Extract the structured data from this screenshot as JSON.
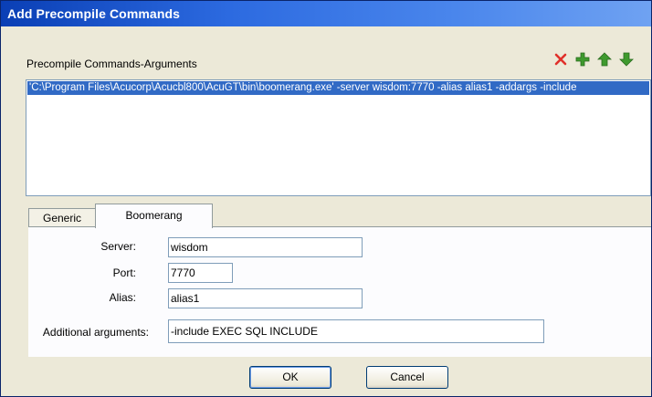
{
  "window": {
    "title": "Add Precompile Commands"
  },
  "commands": {
    "label": "Precompile Commands-Arguments",
    "items": [
      "'C:\\Program Files\\Acucorp\\Acucbl800\\AcuGT\\bin\\boomerang.exe' -server wisdom:7770 -alias alias1 -addargs -include"
    ]
  },
  "toolbar": {
    "icons": [
      "delete-icon",
      "add-icon",
      "move-up-icon",
      "move-down-icon"
    ],
    "colors": {
      "delete": "#e0302a",
      "green": "#3f9a2e"
    }
  },
  "tabs": [
    {
      "label": "Generic"
    },
    {
      "label": "Boomerang"
    }
  ],
  "form": {
    "server": {
      "label": "Server:",
      "value": "wisdom"
    },
    "port": {
      "label": "Port:",
      "value": "7770"
    },
    "alias": {
      "label": "Alias:",
      "value": "alias1"
    },
    "additional": {
      "label": "Additional arguments:",
      "value": "-include EXEC SQL INCLUDE"
    }
  },
  "buttons": {
    "ok": "OK",
    "cancel": "Cancel"
  }
}
